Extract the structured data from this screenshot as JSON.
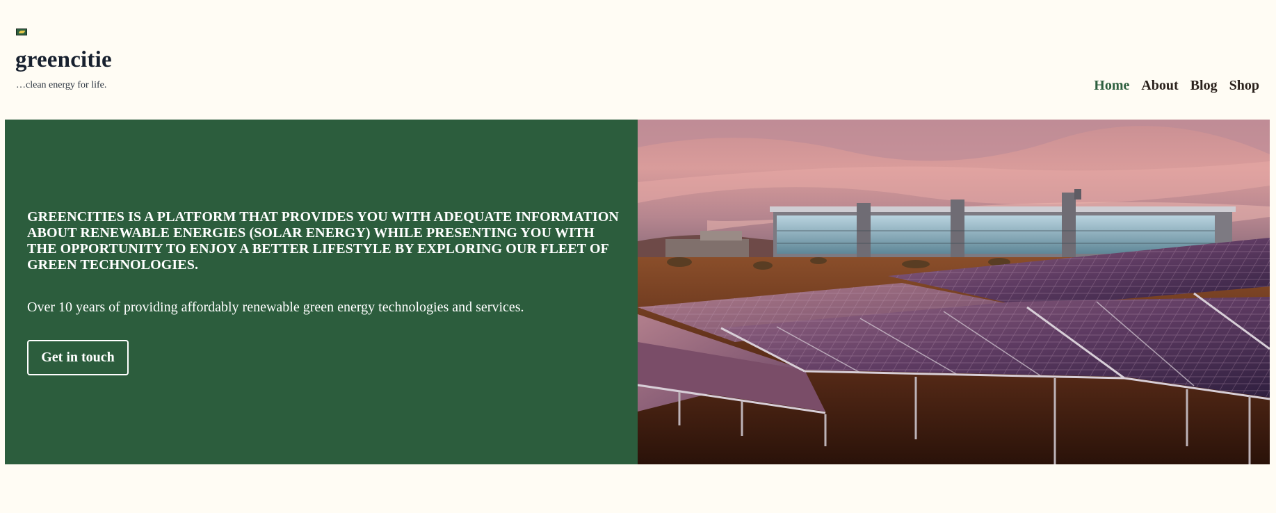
{
  "site": {
    "title": "greencitie",
    "tagline": "…clean energy for life.",
    "logo_icon": "solar-logo-icon"
  },
  "nav": {
    "items": [
      {
        "label": "Home",
        "active": true
      },
      {
        "label": "About",
        "active": false
      },
      {
        "label": "Blog",
        "active": false
      },
      {
        "label": "Shop",
        "active": false
      }
    ]
  },
  "hero": {
    "heading": "GREENCITIES IS A PLATFORM THAT PROVIDES YOU WITH ADEQUATE INFORMATION ABOUT RENEWABLE ENERGIES (SOLAR ENERGY) WHILE PRESENTING YOU WITH THE OPPORTUNITY TO ENJOY A BETTER LIFESTYLE BY EXPLORING OUR FLEET OF GREEN TECHNOLOGIES.",
    "subtext": "Over 10 years of providing affordably renewable green energy technologies and services.",
    "cta_label": "Get in touch",
    "image_subject": "solar-panels-field-with-glass-building-at-dusk"
  },
  "colors": {
    "background": "#fffcf4",
    "brand_green": "#2c5d3d",
    "nav_active": "#2d5f3e",
    "nav_text": "#2a211c",
    "title_text": "#17202e"
  }
}
